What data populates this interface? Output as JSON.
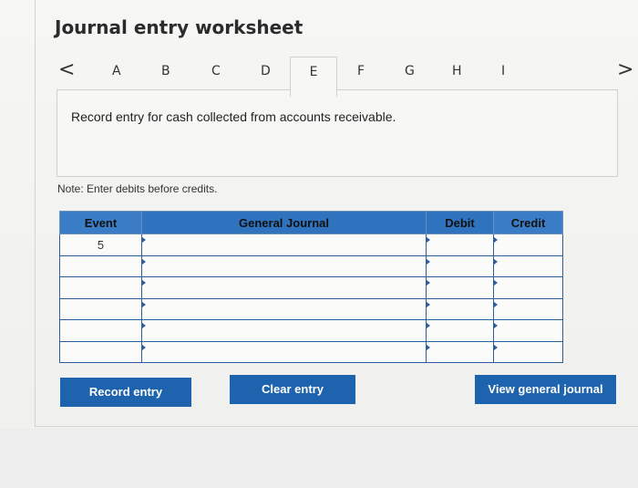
{
  "title": "Journal entry worksheet",
  "tabs": {
    "prev_arrow": "<",
    "next_arrow": ">",
    "items": [
      "A",
      "B",
      "C",
      "D",
      "E",
      "F",
      "G",
      "H",
      "I"
    ],
    "active": "E"
  },
  "prompt": "Record entry for cash collected from accounts receivable.",
  "note": "Note: Enter debits before credits.",
  "table": {
    "headers": [
      "Event",
      "General Journal",
      "Debit",
      "Credit"
    ],
    "rows": [
      {
        "event": "5",
        "account": "",
        "debit": "",
        "credit": ""
      },
      {
        "event": "",
        "account": "",
        "debit": "",
        "credit": ""
      },
      {
        "event": "",
        "account": "",
        "debit": "",
        "credit": ""
      },
      {
        "event": "",
        "account": "",
        "debit": "",
        "credit": ""
      },
      {
        "event": "",
        "account": "",
        "debit": "",
        "credit": ""
      },
      {
        "event": "",
        "account": "",
        "debit": "",
        "credit": ""
      }
    ]
  },
  "buttons": {
    "record": "Record entry",
    "clear": "Clear entry",
    "view": "View general journal"
  }
}
